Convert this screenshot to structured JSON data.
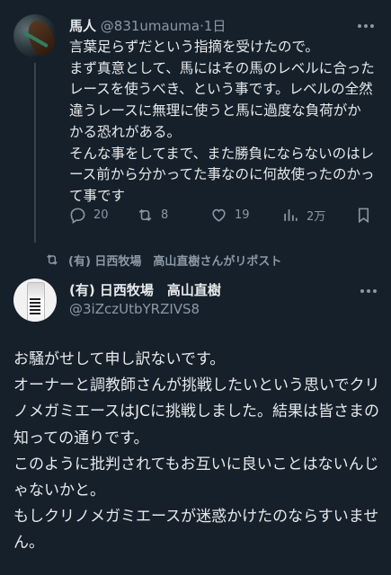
{
  "tweet1": {
    "display_name": "馬人",
    "handle": "@831umauma",
    "separator": "·",
    "time": "1日",
    "text": "言葉足らずだという指摘を受けたので。\nまず真意として、馬にはその馬のレベルに合ったレースを使うべき、という事です。レベルの全然違うレースに無理に使うと馬に過度な負荷がかかる恐れがある。\nそんな事をしてまで、また勝負にならないのはレース前から分かってた事なのに何故使ったのかって事です",
    "replies": "20",
    "reposts": "8",
    "likes": "19",
    "views": "2万",
    "icons": [
      "reply-icon",
      "repost-icon",
      "like-icon",
      "views-icon",
      "bookmark-icon",
      "more-icon"
    ]
  },
  "repost_notice": "(有) 日西牧場　高山直樹さんがリポスト",
  "tweet2": {
    "display_name": "(有) 日西牧場　高山直樹",
    "handle": "@3iZczUtbYRZIVS8",
    "text": "お騒がせして申し訳ないです。\nオーナーと調教師さんが挑戦したいという思いでクリノメガミエースはJCに挑戦しました。結果は皆さまの知っての通りです。\nこのように批判されてもお互いに良いことはないんじゃないかと。\nもしクリノメガミエースが迷惑かけたのならすいません。"
  },
  "colors": {
    "background": "#15202b",
    "text_primary": "#e7e9ea",
    "text_secondary": "#8b98a5",
    "divider": "#38444d"
  }
}
